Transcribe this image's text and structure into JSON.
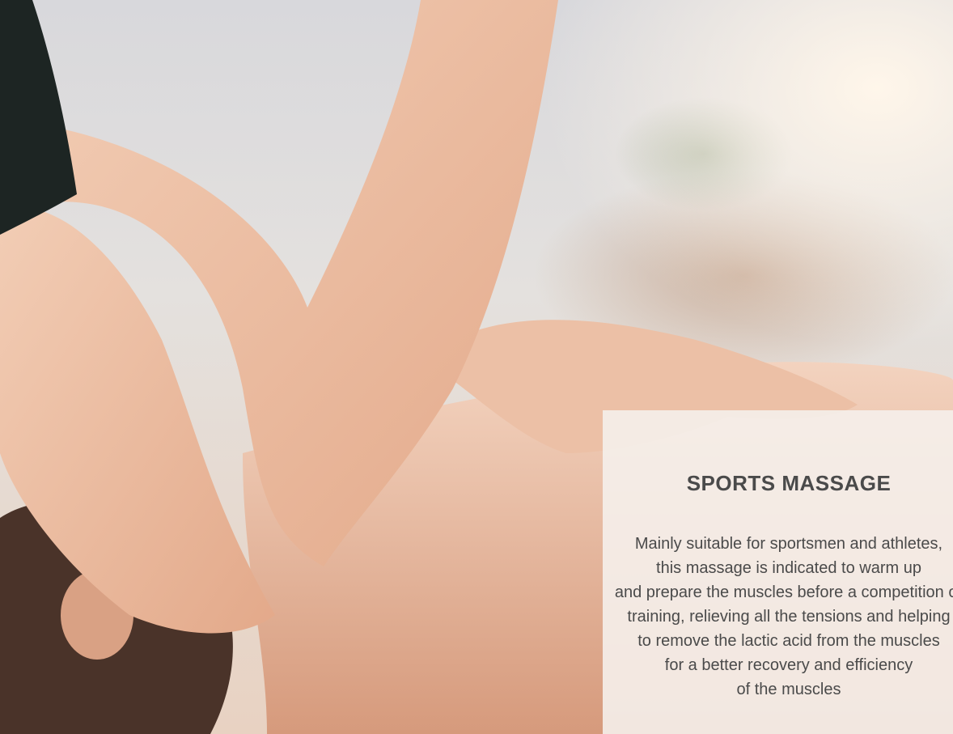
{
  "card": {
    "title": "SPORTS MASSAGE",
    "lines": [
      "Mainly suitable for sportsmen and athletes,",
      "this massage is indicated to warm up",
      "and prepare the muscles before a competition or",
      "training, relieving all the tensions and helping",
      "to remove the lactic acid from the muscles",
      "for a better recovery and efficiency",
      "of the muscles"
    ]
  },
  "colors": {
    "card_background": "#f5f0eb",
    "text": "#4a4a4a"
  }
}
